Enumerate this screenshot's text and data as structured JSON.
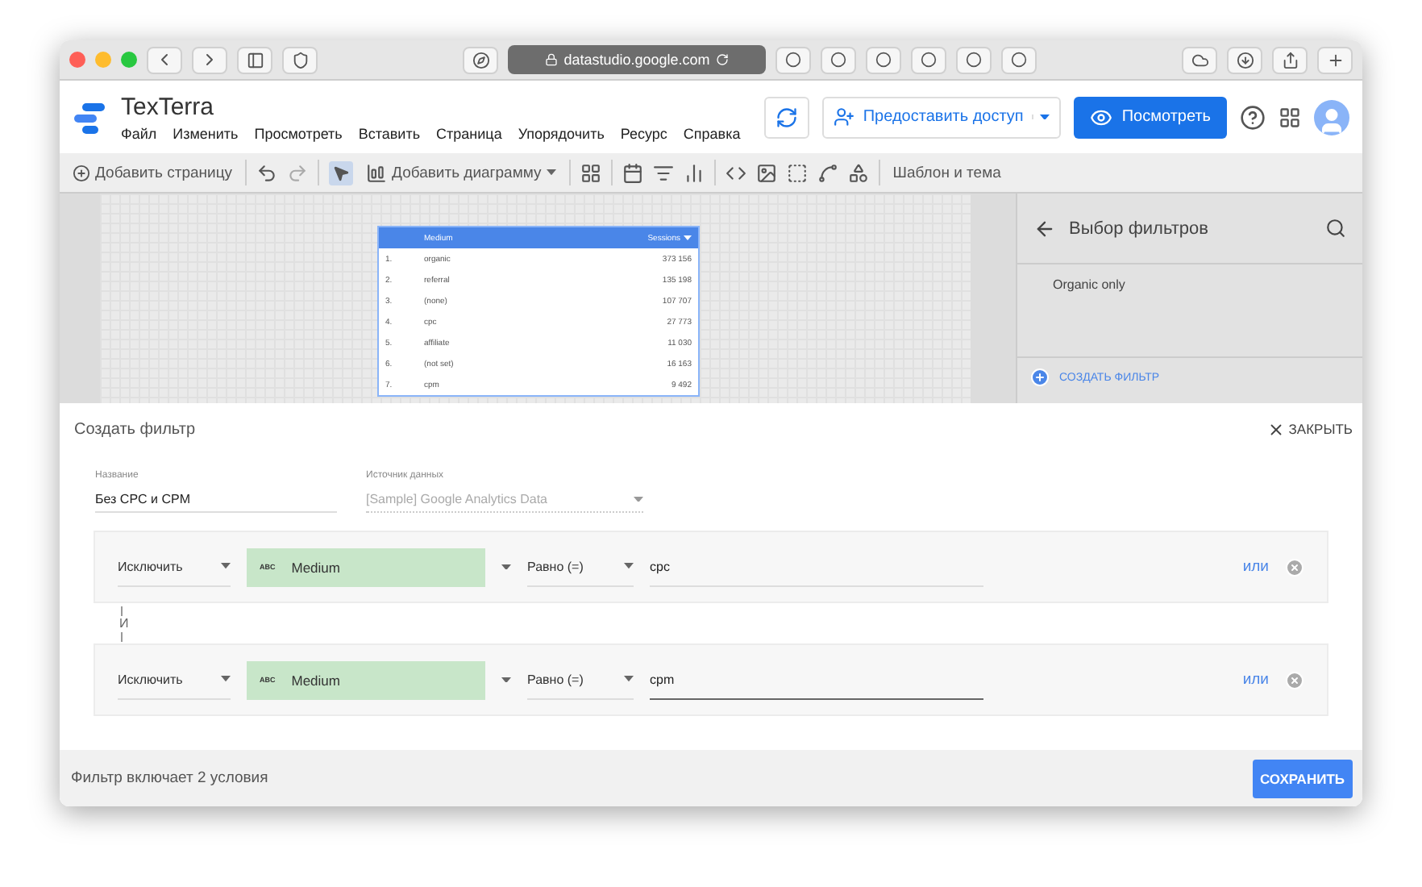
{
  "browser": {
    "url": "datastudio.google.com"
  },
  "app": {
    "title": "TexTerra",
    "menu": [
      "Файл",
      "Изменить",
      "Просмотреть",
      "Вставить",
      "Страница",
      "Упорядочить",
      "Ресурс",
      "Справка"
    ],
    "share": "Предоставить доступ",
    "view": "Посмотреть"
  },
  "toolbar": {
    "add_page": "Добавить страницу",
    "add_chart": "Добавить диаграмму",
    "theme": "Шаблон и тема",
    "pointer_selected": true
  },
  "table": {
    "columns": [
      "Medium",
      "Sessions"
    ],
    "rows": [
      {
        "index": "1.",
        "medium": "organic",
        "sessions": "373 156"
      },
      {
        "index": "2.",
        "medium": "referral",
        "sessions": "135 198"
      },
      {
        "index": "3.",
        "medium": "(none)",
        "sessions": "107 707"
      },
      {
        "index": "4.",
        "medium": "cpc",
        "sessions": "27 773"
      },
      {
        "index": "5.",
        "medium": "affiliate",
        "sessions": "11 030"
      },
      {
        "index": "6.",
        "medium": "(not set)",
        "sessions": "16 163"
      },
      {
        "index": "7.",
        "medium": "cpm",
        "sessions": "9 492"
      }
    ]
  },
  "filter_panel": {
    "title": "Выбор фильтров",
    "items": [
      "Organic only"
    ],
    "create": "СОЗДАТЬ ФИЛЬТР"
  },
  "dialog": {
    "title": "Создать фильтр",
    "close": "ЗАКРЫТЬ",
    "name_label": "Название",
    "name_value": "Без CPC и CPM",
    "source_label": "Источник данных",
    "source_value": "[Sample] Google Analytics Data",
    "source_disabled": true,
    "conditions": [
      {
        "mode": "Исключить",
        "field_type": "ABC",
        "field": "Medium",
        "operator": "Равно (=)",
        "value": "cpc",
        "focused": false,
        "or": "или"
      },
      {
        "mode": "Исключить",
        "field_type": "ABC",
        "field": "Medium",
        "operator": "Равно (=)",
        "value": "cpm",
        "focused": true,
        "or": "или"
      }
    ],
    "connector": "И",
    "summary": "Фильтр включает 2 условия",
    "save": "СОХРАНИТЬ"
  }
}
